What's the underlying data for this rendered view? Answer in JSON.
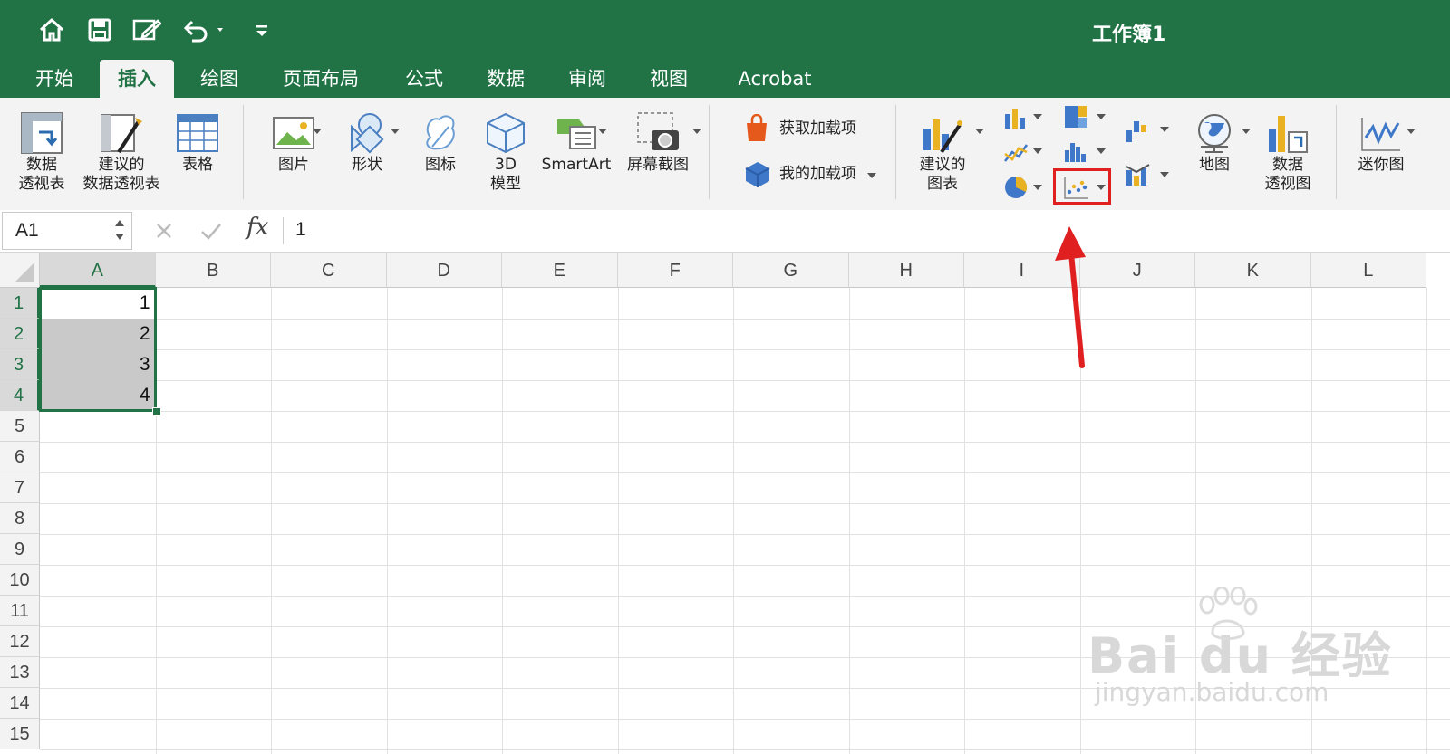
{
  "window": {
    "title": "工作簿1"
  },
  "quick_access": [
    "home-icon",
    "save-icon",
    "edit-icon",
    "undo-icon",
    "customize-icon"
  ],
  "tabs": [
    {
      "label": "开始"
    },
    {
      "label": "插入",
      "active": true
    },
    {
      "label": "绘图"
    },
    {
      "label": "页面布局"
    },
    {
      "label": "公式"
    },
    {
      "label": "数据"
    },
    {
      "label": "审阅"
    },
    {
      "label": "视图"
    },
    {
      "label": "Acrobat"
    }
  ],
  "ribbon": {
    "pivot_table": "数据\n透视表",
    "recommended_pivot": "建议的\n数据透视表",
    "table": "表格",
    "pictures": "图片",
    "shapes": "形状",
    "icons": "图标",
    "model3d": "3D\n模型",
    "smartart": "SmartArt",
    "screenshot": "屏幕截图",
    "get_addins": "获取加载项",
    "my_addins": "我的加载项",
    "recommended_charts": "建议的\n图表",
    "maps": "地图",
    "pivot_chart": "数据\n透视图",
    "sparklines": "迷你图"
  },
  "formula_bar": {
    "name_box": "A1",
    "fx": "fx",
    "value": "1"
  },
  "grid": {
    "columns": [
      "A",
      "B",
      "C",
      "D",
      "E",
      "F",
      "G",
      "H",
      "I",
      "J",
      "K",
      "L"
    ],
    "rows": [
      "1",
      "2",
      "3",
      "4",
      "5",
      "6",
      "7",
      "8",
      "9",
      "10",
      "11",
      "12",
      "13",
      "14",
      "15"
    ],
    "cells": {
      "A1": "1",
      "A2": "2",
      "A3": "3",
      "A4": "4"
    }
  },
  "watermark": {
    "brand": "Bai du 经验",
    "url": "jingyan.baidu.com"
  },
  "colors": {
    "accent": "#217346",
    "highlight": "#e02020"
  }
}
